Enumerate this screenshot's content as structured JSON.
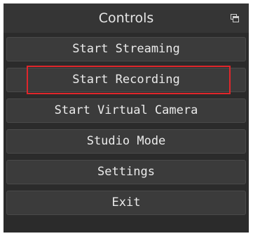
{
  "dock": {
    "title": "Controls",
    "float_icon": "float-dock-icon"
  },
  "buttons": [
    {
      "label": "Start Streaming"
    },
    {
      "label": "Start Recording"
    },
    {
      "label": "Start Virtual Camera"
    },
    {
      "label": "Studio Mode"
    },
    {
      "label": "Settings"
    },
    {
      "label": "Exit"
    }
  ],
  "highlight": {
    "target": "Start Recording",
    "color": "#e0262b"
  },
  "colors": {
    "panel_bg": "#2b2b2b",
    "title_bg": "#353535",
    "button_bg": "#3b3b3b",
    "text": "#ebebeb"
  }
}
